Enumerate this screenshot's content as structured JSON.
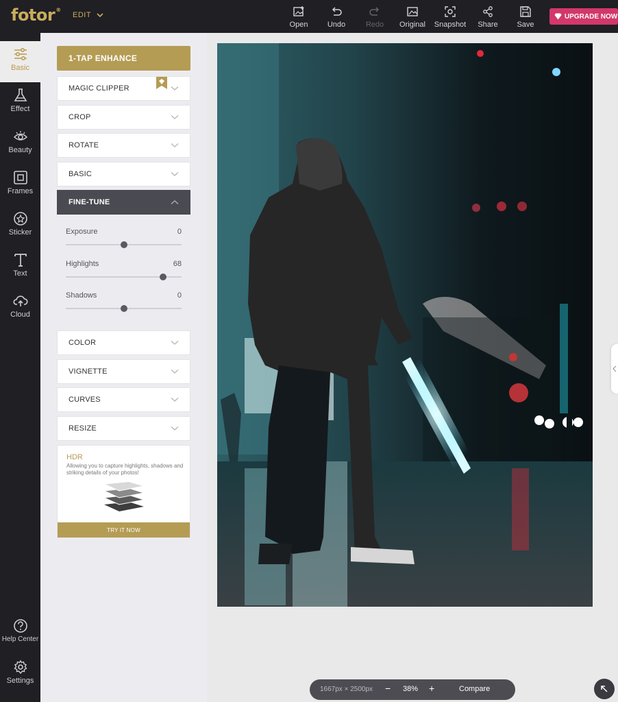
{
  "app": {
    "logo": "fotor",
    "logo_mark": "®",
    "edit_menu": "EDIT"
  },
  "toolbar": {
    "items": [
      {
        "label": "Open",
        "icon": "open-image-icon"
      },
      {
        "label": "Undo",
        "icon": "undo-icon"
      },
      {
        "label": "Redo",
        "icon": "redo-icon",
        "disabled": true
      },
      {
        "label": "Original",
        "icon": "original-image-icon"
      },
      {
        "label": "Snapshot",
        "icon": "snapshot-icon"
      },
      {
        "label": "Share",
        "icon": "share-icon"
      },
      {
        "label": "Save",
        "icon": "save-icon"
      }
    ],
    "upgrade_label": "UPGRADE NOW"
  },
  "nav": {
    "items": [
      {
        "label": "Basic",
        "icon": "sliders-icon",
        "active": true
      },
      {
        "label": "Effect",
        "icon": "flask-icon"
      },
      {
        "label": "Beauty",
        "icon": "eye-icon"
      },
      {
        "label": "Frames",
        "icon": "frame-icon"
      },
      {
        "label": "Sticker",
        "icon": "star-icon"
      },
      {
        "label": "Text",
        "icon": "text-icon"
      },
      {
        "label": "Cloud",
        "icon": "cloud-upload-icon"
      }
    ],
    "bottom": [
      {
        "label": "Help Center",
        "icon": "help-icon"
      },
      {
        "label": "Settings",
        "icon": "gear-icon"
      }
    ]
  },
  "panel": {
    "enhance_label": "1-TAP ENHANCE",
    "sections_top": [
      "MAGIC CLIPPER",
      "CROP",
      "ROTATE",
      "BASIC"
    ],
    "open_section": "FINE-TUNE",
    "sliders": [
      {
        "label": "Exposure",
        "value": "0",
        "fraction": 0.5
      },
      {
        "label": "Highlights",
        "value": "68",
        "fraction": 0.84
      },
      {
        "label": "Shadows",
        "value": "0",
        "fraction": 0.5
      }
    ],
    "sections_bottom": [
      "COLOR",
      "VIGNETTE",
      "CURVES",
      "RESIZE"
    ],
    "hdr": {
      "title": "HDR",
      "description": "Allowing you to capture highlights, shadows and striking details of your photos!",
      "button": "TRY IT NOW"
    }
  },
  "canvas": {
    "dimensions": "1667px × 2500px",
    "zoom_minus": "−",
    "zoom": "38%",
    "zoom_plus": "+",
    "compare_label": "Compare"
  },
  "colors": {
    "accent_gold": "#b59c54",
    "upgrade_pink": "#d2386a",
    "dark_bg": "#1f1f24"
  }
}
